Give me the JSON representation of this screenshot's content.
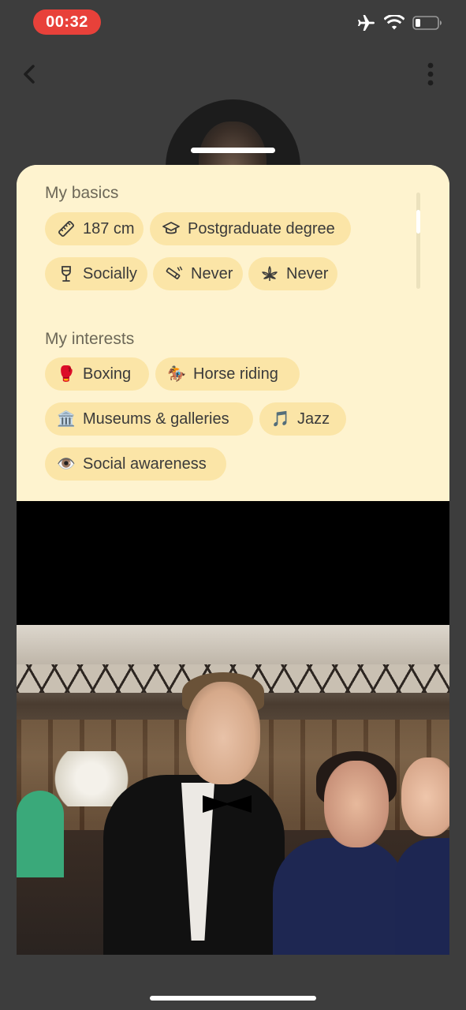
{
  "status_bar": {
    "time": "00:32",
    "icons": [
      "airplane-icon",
      "wifi-icon",
      "battery-icon"
    ],
    "time_color": "#e8413a"
  },
  "nav": {
    "back_icon": "chevron-left-icon",
    "more_icon": "more-vertical-icon"
  },
  "profile": {
    "basics": {
      "title": "My basics",
      "items": [
        {
          "icon": "ruler-icon",
          "label": "187 cm"
        },
        {
          "icon": "graduation-cap-icon",
          "label": "Postgraduate degree"
        },
        {
          "icon": "wine-glass-icon",
          "label": "Socially"
        },
        {
          "icon": "smoking-icon",
          "label": "Never"
        },
        {
          "icon": "cannabis-leaf-icon",
          "label": "Never"
        }
      ]
    },
    "interests": {
      "title": "My interests",
      "items": [
        {
          "emoji": "🥊",
          "label": "Boxing"
        },
        {
          "emoji": "🏇",
          "label": "Horse riding"
        },
        {
          "emoji": "🏛️",
          "label": "Museums & galleries"
        },
        {
          "emoji": "🎵",
          "label": "Jazz"
        },
        {
          "emoji": "👁️",
          "label": "Social awareness"
        }
      ]
    }
  },
  "colors": {
    "background": "#3d3d3d",
    "sheet": "#fef3cf",
    "chip": "#fbe5a7"
  }
}
